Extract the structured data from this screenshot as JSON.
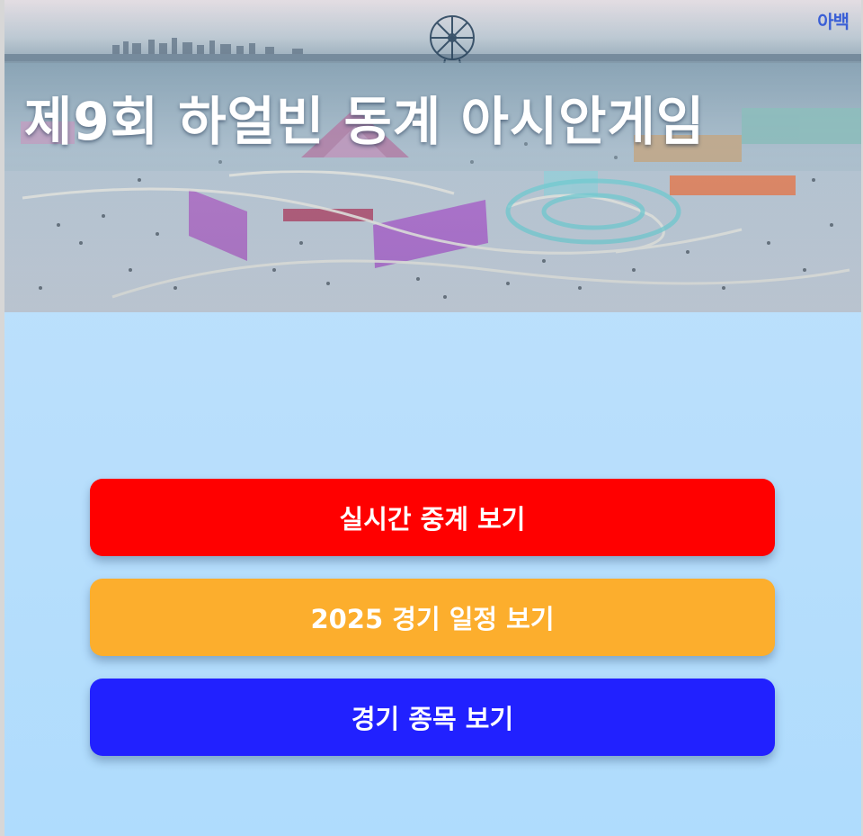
{
  "header": {
    "title": "제9회 하얼빈 동계 아시안게임",
    "logo_text": "아백"
  },
  "buttons": [
    {
      "label": "실시간 중계 보기",
      "color": "#ff0000"
    },
    {
      "label": "2025 경기 일정 보기",
      "color": "#fcae2d"
    },
    {
      "label": "경기 종목 보기",
      "color": "#2121ff"
    }
  ],
  "colors": {
    "background": "#b7defc",
    "logo": "#3a5fd6"
  }
}
